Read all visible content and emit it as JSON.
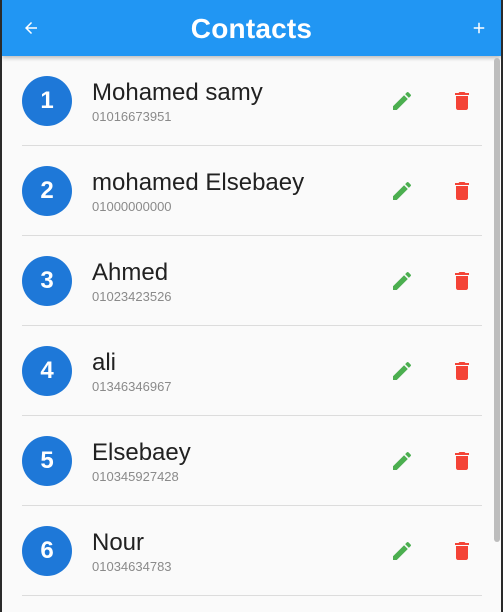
{
  "app": {
    "title": "Contacts"
  },
  "colors": {
    "appbar": "#2196f3",
    "avatar": "#1e78d8",
    "edit": "#4caf50",
    "delete": "#f44336"
  },
  "icons": {
    "back": "arrow-back-icon",
    "add": "plus-icon",
    "edit": "pencil-icon",
    "delete": "trash-icon"
  },
  "contacts": [
    {
      "index": "1",
      "name": "Mohamed samy",
      "phone": "01016673951"
    },
    {
      "index": "2",
      "name": "mohamed Elsebaey",
      "phone": "01000000000"
    },
    {
      "index": "3",
      "name": "Ahmed",
      "phone": "01023423526"
    },
    {
      "index": "4",
      "name": "ali",
      "phone": "01346346967"
    },
    {
      "index": "5",
      "name": "Elsebaey",
      "phone": "010345927428"
    },
    {
      "index": "6",
      "name": "Nour",
      "phone": "01034634783"
    }
  ]
}
